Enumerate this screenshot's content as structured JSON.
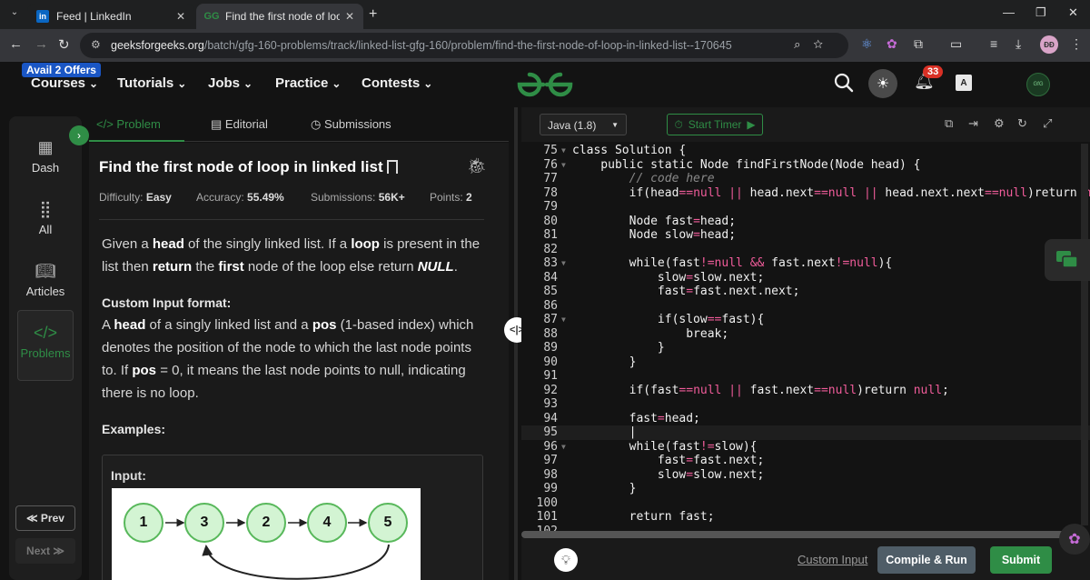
{
  "browser": {
    "tabs": [
      {
        "favicon": "in",
        "title": "Feed | LinkedIn"
      },
      {
        "favicon": "GG",
        "title": "Find the first node of loop in lin"
      }
    ],
    "new_tab": "+",
    "window_controls": [
      "—",
      "❐",
      "✕"
    ],
    "url_domain": "geeksforgeeks.org",
    "url_path": "/batch/gfg-160-problems/track/linked-list-gfg-160/problem/find-the-first-node-of-loop-in-linked-list--170645",
    "profile_initials": "ĐĐ"
  },
  "site_nav": {
    "offer_badge": "Avail 2 Offers",
    "items": [
      "Courses",
      "Tutorials",
      "Jobs",
      "Practice",
      "Contests"
    ],
    "notification_count": "33",
    "translate_label": "A",
    "user_avatar_text": "GfG"
  },
  "sidebar": {
    "items": [
      "Dash",
      "All",
      "Articles",
      "Problems"
    ],
    "prev_label": "≪ Prev",
    "next_label": "Next ≫"
  },
  "problem": {
    "tabs": [
      "</> Problem",
      "Editorial",
      "Submissions"
    ],
    "title": "Find the first node of loop in linked list",
    "difficulty_label": "Difficulty:",
    "difficulty": "Easy",
    "accuracy_label": "Accuracy:",
    "accuracy": "55.49%",
    "submissions_label": "Submissions:",
    "submissions": "56K+",
    "points_label": "Points:",
    "points": "2",
    "description": {
      "p1_a": "Given a ",
      "p1_b": "head",
      "p1_c": " of the singly linked list. If a ",
      "p1_d": "loop",
      "p1_e": " is present in the list then ",
      "p1_f": "return",
      "p1_g": " the ",
      "p1_h": "first",
      "p1_i": " node of the loop else return ",
      "p1_j": "NULL",
      "p1_k": "."
    },
    "custom_input_heading": "Custom Input format:",
    "custom_input": {
      "a": "A ",
      "b": "head",
      "c": " of a singly linked list and a ",
      "d": "pos",
      "e": " (1-based index) which denotes the position of the node to which the last node points to. If ",
      "f": "pos",
      "g": " = 0, it means the last node points to null, indicating there is no loop."
    },
    "examples_heading": "Examples:",
    "input_label": "Input:",
    "diagram_nodes": [
      "1",
      "3",
      "2",
      "4",
      "5"
    ]
  },
  "editor": {
    "language": "Java (1.8)",
    "timer_label": "Start Timer",
    "lines": [
      {
        "n": "75",
        "fold": true,
        "code": "class Solution {"
      },
      {
        "n": "76",
        "fold": true,
        "code": "    public static Node findFirstNode(Node head) {"
      },
      {
        "n": "77",
        "fold": false,
        "code": "        // code here",
        "comment": true
      },
      {
        "n": "78",
        "fold": false,
        "code": "        if(head==null || head.next==null || head.next.next==null)return null;"
      },
      {
        "n": "79",
        "fold": false,
        "code": ""
      },
      {
        "n": "80",
        "fold": false,
        "code": "        Node fast=head;"
      },
      {
        "n": "81",
        "fold": false,
        "code": "        Node slow=head;"
      },
      {
        "n": "82",
        "fold": false,
        "code": ""
      },
      {
        "n": "83",
        "fold": true,
        "code": "        while(fast!=null && fast.next!=null){"
      },
      {
        "n": "84",
        "fold": false,
        "code": "            slow=slow.next;"
      },
      {
        "n": "85",
        "fold": false,
        "code": "            fast=fast.next.next;"
      },
      {
        "n": "86",
        "fold": false,
        "code": ""
      },
      {
        "n": "87",
        "fold": true,
        "code": "            if(slow==fast){"
      },
      {
        "n": "88",
        "fold": false,
        "code": "                break;"
      },
      {
        "n": "89",
        "fold": false,
        "code": "            }"
      },
      {
        "n": "90",
        "fold": false,
        "code": "        }"
      },
      {
        "n": "91",
        "fold": false,
        "code": ""
      },
      {
        "n": "92",
        "fold": false,
        "code": "        if(fast==null || fast.next==null)return null;"
      },
      {
        "n": "93",
        "fold": false,
        "code": ""
      },
      {
        "n": "94",
        "fold": false,
        "code": "        fast=head;"
      },
      {
        "n": "95",
        "fold": false,
        "code": "        |"
      },
      {
        "n": "96",
        "fold": true,
        "code": "        while(fast!=slow){"
      },
      {
        "n": "97",
        "fold": false,
        "code": "            fast=fast.next;"
      },
      {
        "n": "98",
        "fold": false,
        "code": "            slow=slow.next;"
      },
      {
        "n": "99",
        "fold": false,
        "code": "        }"
      },
      {
        "n": "100",
        "fold": false,
        "code": ""
      },
      {
        "n": "101",
        "fold": false,
        "code": "        return fast;"
      },
      {
        "n": "102",
        "fold": false,
        "code": ""
      }
    ],
    "custom_input_label": "Custom Input",
    "compile_label": "Compile & Run",
    "submit_label": "Submit"
  },
  "colors": {
    "brand_green": "#2f8d46",
    "operator_pink": "#f05c9a",
    "badge_red": "#d93025"
  }
}
